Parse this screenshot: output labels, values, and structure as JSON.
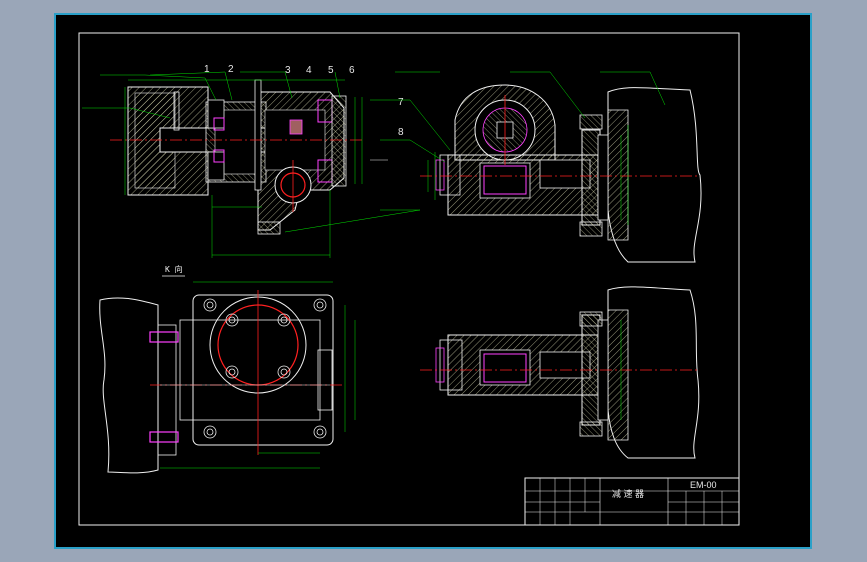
{
  "colors": {
    "app_background": "#9aa6b8",
    "canvas": "#000000",
    "frame_outline": "#2aa0c8",
    "outline": "#f0f0f0",
    "hatch": "#d8d8b0",
    "centerline": "#ff2020",
    "dimension": "#00e000",
    "bolt": "#ff40ff",
    "part_section": "#a06060"
  },
  "balloons": [
    "1",
    "2",
    "3",
    "4",
    "5",
    "6",
    "7",
    "8"
  ],
  "view_label": "K 向",
  "title_block": {
    "drawing_number": "EM-00",
    "drawing_name": "减 速 器"
  }
}
